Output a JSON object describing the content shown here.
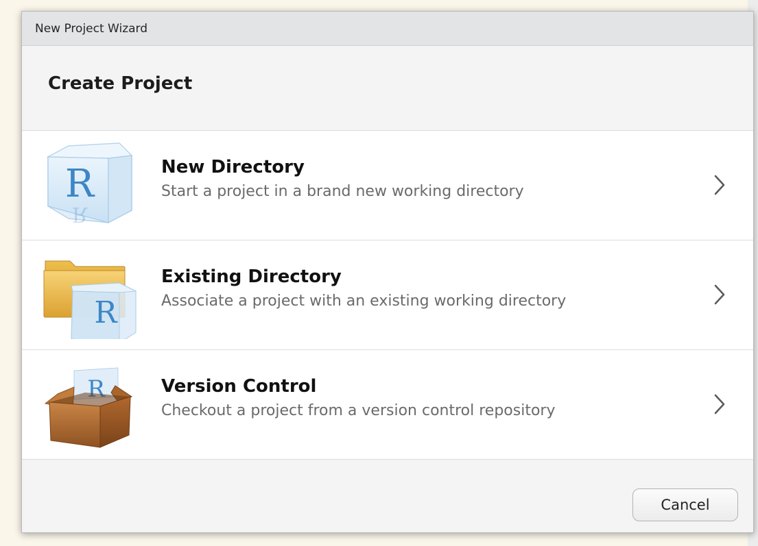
{
  "window": {
    "title": "New Project Wizard"
  },
  "header": {
    "title": "Create Project"
  },
  "options": [
    {
      "title": "New Directory",
      "description": "Start a project in a brand new working directory",
      "icon": "r-cube-icon"
    },
    {
      "title": "Existing Directory",
      "description": "Associate a project with an existing working directory",
      "icon": "folder-r-icon"
    },
    {
      "title": "Version Control",
      "description": "Checkout a project from a version control repository",
      "icon": "box-r-icon"
    }
  ],
  "footer": {
    "cancel_label": "Cancel"
  },
  "icon_letter": "R",
  "colors": {
    "r_blue": "#3d86c6",
    "folder_yellow": "#f0c04a",
    "box_brown": "#b9743a",
    "titlebar": "#e3e4e6"
  }
}
